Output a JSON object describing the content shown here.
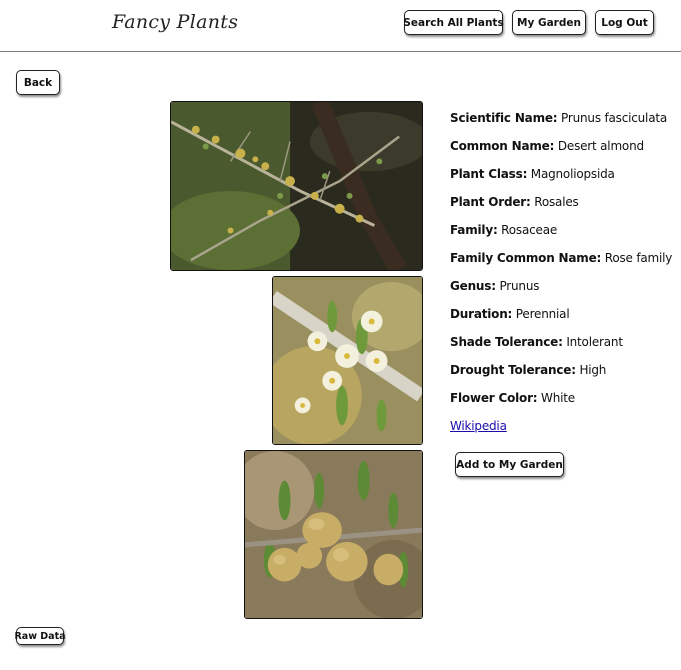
{
  "header": {
    "logo": "Fancy Plants",
    "nav": {
      "search_all": "Search All Plants",
      "my_garden": "My Garden",
      "log_out": "Log Out"
    }
  },
  "back_label": "Back",
  "details": [
    {
      "label": "Scientific Name:",
      "value": "Prunus fasciculata"
    },
    {
      "label": "Common Name:",
      "value": "Desert almond"
    },
    {
      "label": "Plant Class:",
      "value": "Magnoliopsida"
    },
    {
      "label": "Plant Order:",
      "value": "Rosales"
    },
    {
      "label": "Family:",
      "value": "Rosaceae"
    },
    {
      "label": "Family Common Name:",
      "value": "Rose family"
    },
    {
      "label": "Genus:",
      "value": "Prunus"
    },
    {
      "label": "Duration:",
      "value": "Perennial"
    },
    {
      "label": "Shade Tolerance:",
      "value": "Intolerant"
    },
    {
      "label": "Drought Tolerance:",
      "value": "High"
    },
    {
      "label": "Flower Color:",
      "value": "White"
    }
  ],
  "wikipedia_link": "Wikipedia",
  "add_to_garden": "Add to My Garden",
  "raw_data": "Raw Data"
}
